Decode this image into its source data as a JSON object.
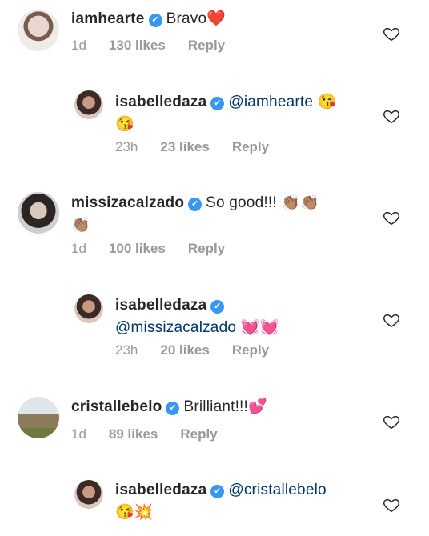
{
  "comments": [
    {
      "username": "iamhearte",
      "text": "Bravo",
      "emojis": "❤️",
      "time": "1d",
      "likes": "130 likes",
      "reply": "Reply",
      "avatar_icon": "profile-photo-iamhearte",
      "verified": true
    },
    {
      "username": "isabelledaza",
      "mention": "@iamhearte",
      "emojis": "😘",
      "emojis_line2": "😘",
      "time": "23h",
      "likes": "23 likes",
      "reply": "Reply",
      "avatar_icon": "profile-photo-isabelledaza",
      "verified": true
    },
    {
      "username": "missizacalzado",
      "text": "So good!!!",
      "emojis": "👏🏽👏🏽",
      "emojis_line2": "👏🏽",
      "time": "1d",
      "likes": "100 likes",
      "reply": "Reply",
      "avatar_icon": "profile-photo-missizacalzado",
      "verified": true
    },
    {
      "username": "isabelledaza",
      "mention": "@missizacalzado",
      "emojis": "💓💓",
      "time": "23h",
      "likes": "20 likes",
      "reply": "Reply",
      "avatar_icon": "profile-photo-isabelledaza",
      "verified": true
    },
    {
      "username": "cristallebelo",
      "text": "Brilliant!!!",
      "emojis": "💕",
      "time": "1d",
      "likes": "89 likes",
      "reply": "Reply",
      "avatar_icon": "profile-photo-cristallebelo",
      "verified": true
    },
    {
      "username": "isabelledaza",
      "mention": "@cristallebelo",
      "emojis_line2": "😘💥",
      "avatar_icon": "profile-photo-isabelledaza",
      "verified": true
    }
  ],
  "icons": {
    "verified": "verified-badge-icon",
    "like": "heart-outline-icon"
  },
  "colors": {
    "verified_blue": "#3897f0",
    "meta_gray": "#999999",
    "mention_blue": "#003569",
    "text": "#262626"
  }
}
